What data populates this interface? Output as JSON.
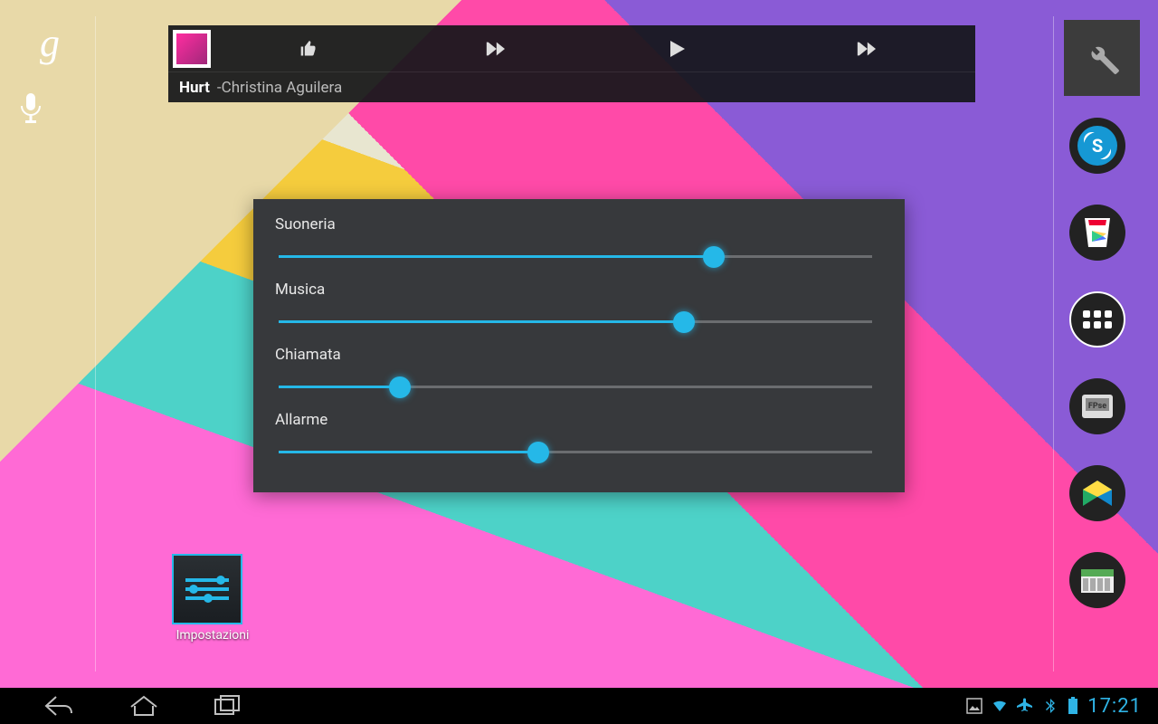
{
  "music": {
    "title": "Hurt",
    "separator": " - ",
    "artist": "Christina Aguilera"
  },
  "volume": {
    "sliders": [
      {
        "label": "Suoneria",
        "percent": 72
      },
      {
        "label": "Musica",
        "percent": 67
      },
      {
        "label": "Chiamata",
        "percent": 20
      },
      {
        "label": "Allarme",
        "percent": 43
      }
    ]
  },
  "desktop": {
    "app_label": "Impostazioni"
  },
  "dock": {
    "icons": [
      "skype",
      "play-store",
      "apps",
      "fpse",
      "books",
      "widget"
    ]
  },
  "statusbar": {
    "time": "17:21"
  },
  "colors": {
    "accent": "#25b8e8"
  }
}
